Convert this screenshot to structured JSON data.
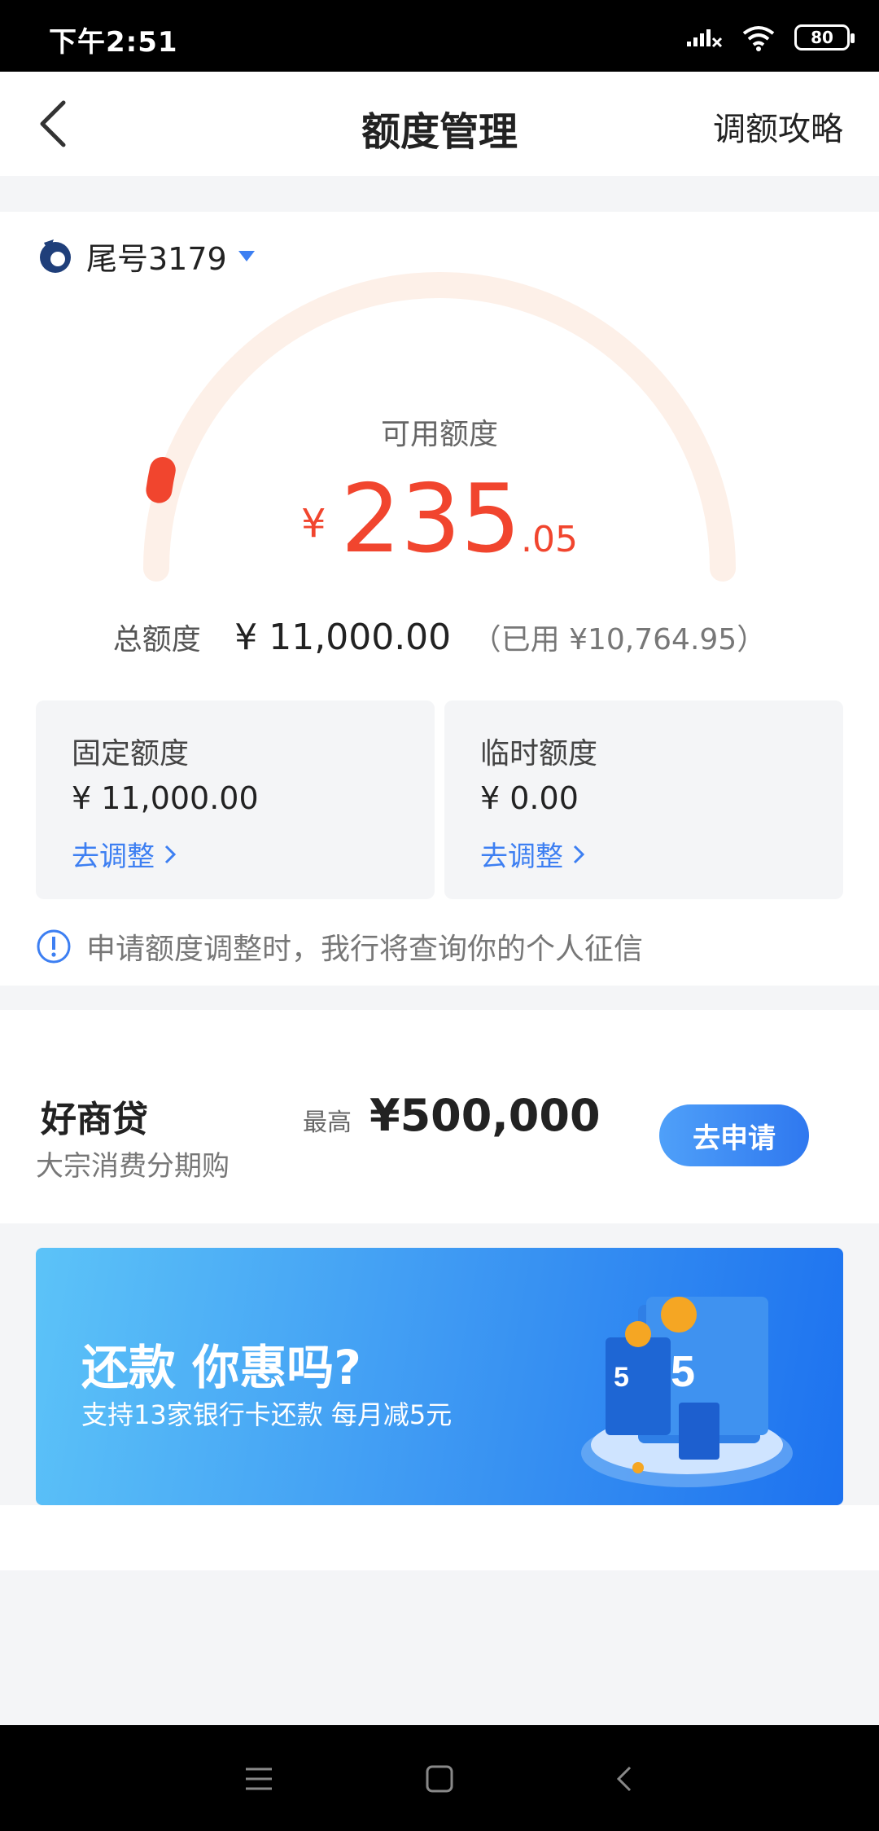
{
  "status_bar": {
    "time": "下午2:51",
    "battery": "80"
  },
  "nav": {
    "title": "额度管理",
    "action": "调额攻略"
  },
  "card": {
    "tail_number": "尾号3179"
  },
  "available": {
    "label": "可用额度",
    "currency": "¥",
    "integer": "235",
    "decimal": ".05",
    "fraction_of_total": 0.021
  },
  "total": {
    "label": "总额度",
    "amount": "¥ 11,000.00",
    "used": "（已用 ¥10,764.95）"
  },
  "fixed_quota": {
    "title": "固定额度",
    "amount": "¥ 11,000.00",
    "link": "去调整"
  },
  "temp_quota": {
    "title": "临时额度",
    "amount": "¥ 0.00",
    "link": "去调整"
  },
  "notice": "申请额度调整时，我行将查询你的个人征信",
  "loan": {
    "title": "好商贷",
    "subtitle": "大宗消费分期购",
    "max_label": "最高",
    "max_amount": "¥500,000",
    "button": "去申请"
  },
  "banner": {
    "title": "还款 你惠吗?",
    "subtitle": "支持13家银行卡还款 每月减5元"
  },
  "colors": {
    "accent_red": "#f1452e",
    "link_blue": "#3d7ff2",
    "gauge_track": "#fdf0e8"
  }
}
